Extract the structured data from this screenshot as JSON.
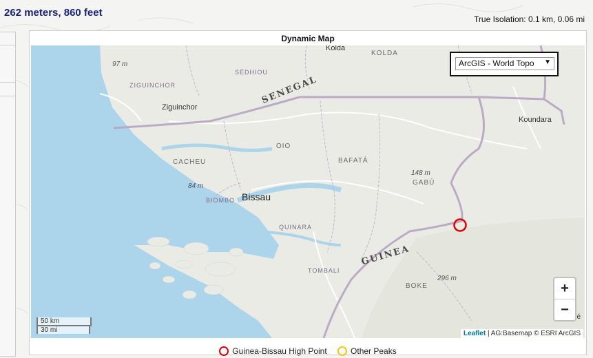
{
  "header": {
    "elevation": "262 meters, 860 feet",
    "isolation": "True Isolation: 0.1 km, 0.06 mi"
  },
  "map": {
    "title": "Dynamic Map",
    "basemap_selected": "ArcGIS - World Topo",
    "labels": {
      "kolda_top": "Kolda",
      "kolda_region": "KOLDA",
      "sedhiou": "SÉDHIOU",
      "ziguinchor_region": "ZIGUINCHOR",
      "ziguinchor_town": "Ziguinchor",
      "senegal": "SENEGAL",
      "koundara": "Koundara",
      "oio": "OIO",
      "bafata": "BAFATÁ",
      "cacheu": "CACHEU",
      "gabu": "GABÚ",
      "bissau": "Bissau",
      "biombo": "BIOMBO",
      "quinara": "QUINARA",
      "tombali": "TOMBALI",
      "guinea": "GUINEA",
      "boke": "BOKE",
      "elev_97": "97 m",
      "elev_84": "84 m",
      "elev_148": "148 m",
      "elev_296": "296 m",
      "edge_text": "Laré"
    },
    "zoom_in": "+",
    "zoom_out": "−",
    "scale_km": "50 km",
    "scale_mi": "30 mi",
    "attribution_link": "Leaflet",
    "attribution_text": " | AG:Basemap © ESRI ArcGIS"
  },
  "legend": {
    "high_point": "Guinea-Bissau High Point",
    "other_peaks": "Other Peaks"
  },
  "colors": {
    "high_point_ring": "#e00000",
    "other_peaks_ring": "#f5c518",
    "sea": "#acd4eb",
    "land": "#e9ebe4",
    "border": "#b7a3c2"
  }
}
